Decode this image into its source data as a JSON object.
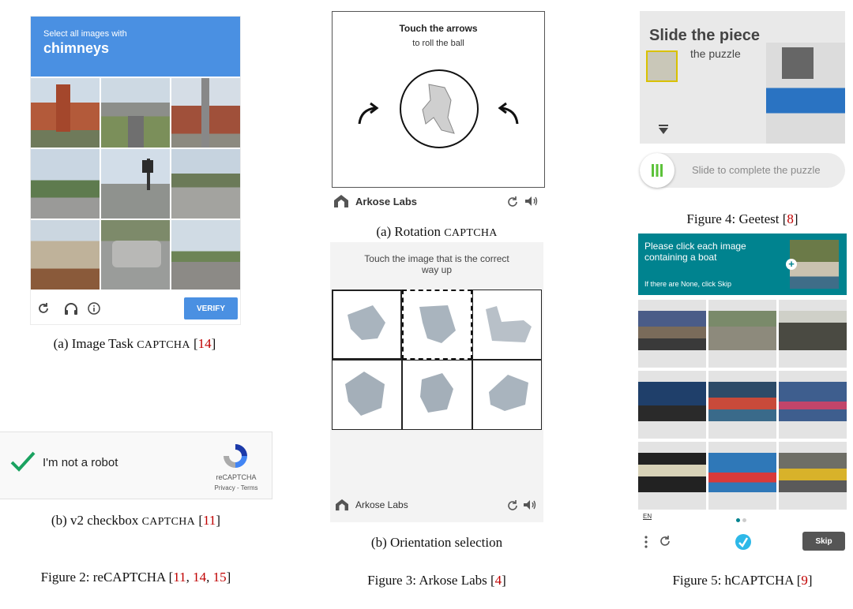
{
  "fig2": {
    "image_task": {
      "prompt": "Select all images with",
      "object": "chimneys",
      "verify": "VERIFY",
      "caption_pre": "(a) Image Task ",
      "caption_sc": "CAPTCHA",
      "caption_open": " [",
      "caption_ref": "14",
      "caption_close": "]"
    },
    "checkbox": {
      "label": "I'm not a robot",
      "brand": "reCAPTCHA",
      "terms": "Privacy - Terms",
      "caption_pre": "(b) v2 checkbox ",
      "caption_sc": "CAPTCHA",
      "caption_open": " [",
      "caption_ref": "11",
      "caption_close": "]"
    },
    "caption_pre": "Figure 2: reCAPTCHA [",
    "caption_refs": [
      "11",
      "14",
      "15"
    ],
    "caption_close": "]"
  },
  "fig3": {
    "rotation": {
      "title": "Touch the arrows",
      "subtitle": "to roll the ball",
      "brand": "Arkose Labs",
      "caption_pre": "(a) Rotation ",
      "caption_sc": "CAPTCHA"
    },
    "orientation": {
      "prompt_line1": "Touch the image that is the correct",
      "prompt_line2": "way up",
      "brand": "Arkose Labs",
      "caption": "(b) Orientation selection"
    },
    "caption_pre": "Figure 3: Arkose Labs [",
    "caption_ref": "4",
    "caption_close": "]"
  },
  "fig4": {
    "title": "Slide the piece",
    "subtitle": "the puzzle",
    "slider_text": "Slide to complete the puzzle",
    "caption_pre": "Figure 4: Geetest [",
    "caption_ref": "8",
    "caption_close": "]"
  },
  "fig5": {
    "prompt": "Please click each image containing a boat",
    "none_hint": "If there are None, click Skip",
    "lang": "EN",
    "skip": "Skip",
    "caption_pre": "Figure 5: hCAPTCHA [",
    "caption_ref": "9",
    "caption_close": "]"
  },
  "colors": {
    "recaptcha_blue": "#4a90e2",
    "hcaptcha_teal": "#00838f",
    "citation_red": "#c00000",
    "check_green": "#1aa260"
  },
  "icons": [
    "reload-icon",
    "headphones-icon",
    "info-icon",
    "recaptcha-logo-icon",
    "arkose-logo-icon",
    "refresh-icon",
    "audio-icon",
    "hcaptcha-logo-icon",
    "menu-dots-icon"
  ]
}
